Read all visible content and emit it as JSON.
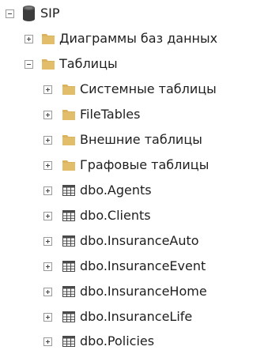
{
  "tree": {
    "root": {
      "label": "SIP",
      "icon": "database-icon",
      "expanded": true
    },
    "diagrams": {
      "label": "Диаграммы баз данных",
      "icon": "folder-icon",
      "expanded": false
    },
    "tables": {
      "label": "Таблицы",
      "icon": "folder-icon",
      "expanded": true
    },
    "table_folders": [
      {
        "label": "Системные таблицы",
        "icon": "folder-icon",
        "expanded": false
      },
      {
        "label": "FileTables",
        "icon": "folder-icon",
        "expanded": false
      },
      {
        "label": "Внешние таблицы",
        "icon": "folder-icon",
        "expanded": false
      },
      {
        "label": "Графовые таблицы",
        "icon": "folder-icon",
        "expanded": false
      }
    ],
    "table_items": [
      {
        "label": "dbo.Agents",
        "icon": "table-icon",
        "expanded": false
      },
      {
        "label": "dbo.Clients",
        "icon": "table-icon",
        "expanded": false
      },
      {
        "label": "dbo.InsuranceAuto",
        "icon": "table-icon",
        "expanded": false
      },
      {
        "label": "dbo.InsuranceEvent",
        "icon": "table-icon",
        "expanded": false
      },
      {
        "label": "dbo.InsuranceHome",
        "icon": "table-icon",
        "expanded": false
      },
      {
        "label": "dbo.InsuranceLife",
        "icon": "table-icon",
        "expanded": false
      },
      {
        "label": "dbo.Policies",
        "icon": "table-icon",
        "expanded": false
      }
    ]
  },
  "colors": {
    "folder": "#dcb35c",
    "database": "#3c3c3c",
    "table_grid": "#4a4a4a",
    "text": "#1e1e1e"
  }
}
